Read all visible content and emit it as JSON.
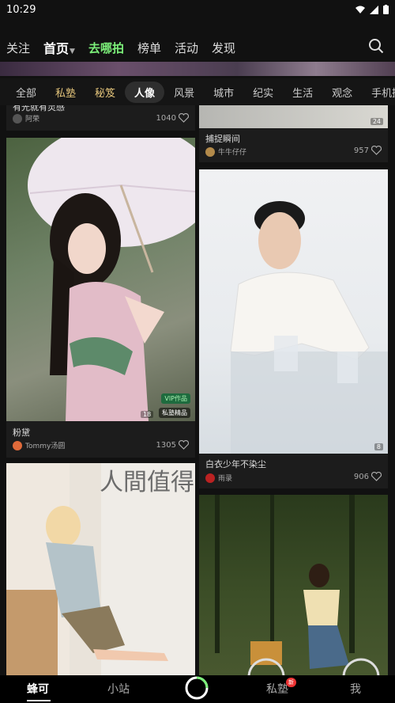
{
  "status_bar": {
    "time": "10:29"
  },
  "top_nav": {
    "items": [
      "关注",
      "首页",
      "去哪拍",
      "榜单",
      "活动",
      "发现"
    ],
    "active_index": 1
  },
  "categories": {
    "items": [
      "全部",
      "私塾",
      "秘笈",
      "人像",
      "风景",
      "城市",
      "纪实",
      "生活",
      "观念",
      "手机摄影"
    ],
    "active": "人像"
  },
  "feed": {
    "cards": [
      {
        "title": "有光就有灵感",
        "author": "阿荣",
        "likes": "1040"
      },
      {
        "title": "捕捉瞬间",
        "author": "牛牛仔仔",
        "likes": "957",
        "image_count": "24"
      },
      {
        "title": "粉黛",
        "author": "Tommy汤圆",
        "likes": "1305",
        "image_count": "18",
        "badge_vip": "VIP作品",
        "badge_private": "私塾精品"
      },
      {
        "title": "白衣少年不染尘",
        "author": "雨录",
        "likes": "906",
        "image_count": "8"
      },
      {
        "poster_text": "人間值得"
      }
    ]
  },
  "bottom_nav": {
    "items": [
      "蜂可",
      "小站",
      "",
      "私塾",
      "我"
    ],
    "new_badge": "新"
  },
  "colors": {
    "accent_green": "#7cf07a",
    "gold": "#e2c37a"
  }
}
